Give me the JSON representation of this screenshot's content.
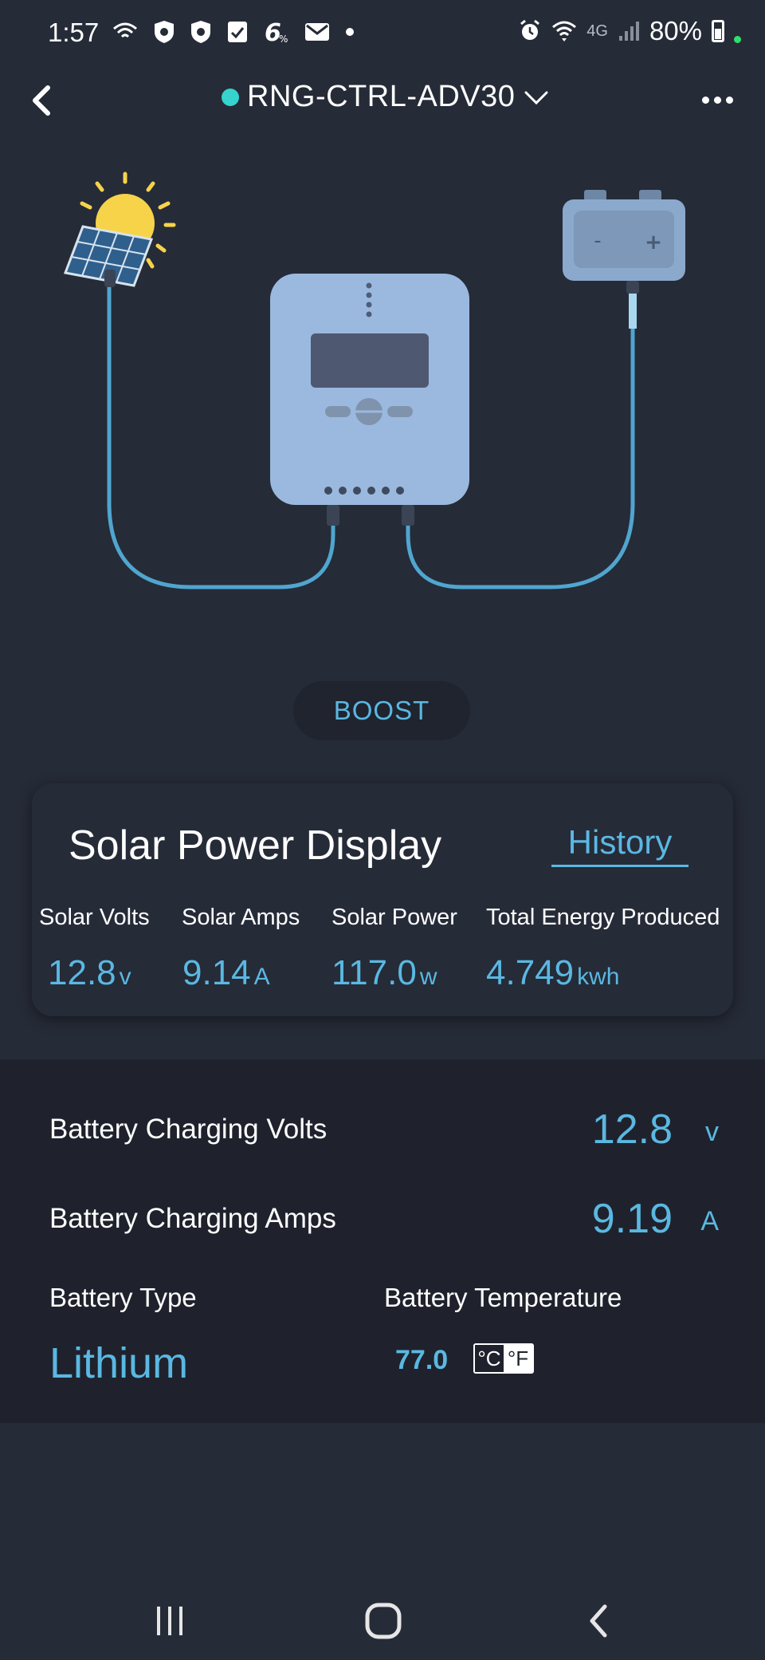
{
  "status_bar": {
    "time": "1:57",
    "left_icons": [
      "wifi-calling-icon",
      "shield-icon",
      "shield-icon",
      "notepad-icon",
      "six-icon",
      "mail-icon",
      "dot-icon"
    ],
    "right_icons": [
      "alarm-icon",
      "wifi-icon",
      "4g-icon",
      "signal-icon"
    ],
    "network": "4G",
    "battery_percent": "80%"
  },
  "header": {
    "device_name": "RNG-CTRL-ADV30",
    "device_status_color": "#36d3cf",
    "back_icon": "chevron-left-icon",
    "dropdown_icon": "chevron-down-icon",
    "more_icon": "more-horizontal-icon"
  },
  "illustration": {
    "battery_minus": "-",
    "battery_plus": "+"
  },
  "boost": {
    "label": "BOOST"
  },
  "solar_power": {
    "title": "Solar Power Display",
    "history_label": "History",
    "metrics": [
      {
        "label": "Solar Volts",
        "value": "12.8",
        "unit": "v"
      },
      {
        "label": "Solar Amps",
        "value": "9.14",
        "unit": "A"
      },
      {
        "label": "Solar Power",
        "value": "117.0",
        "unit": "w"
      },
      {
        "label": "Total Energy Produced",
        "value": "4.749",
        "unit": "kwh"
      }
    ]
  },
  "battery": {
    "charging_volts": {
      "label": "Battery Charging Volts",
      "value": "12.8",
      "unit": "v"
    },
    "charging_amps": {
      "label": "Battery Charging Amps",
      "value": "9.19",
      "unit": "A"
    },
    "type": {
      "label": "Battery Type",
      "value": "Lithium"
    },
    "temperature": {
      "label": "Battery Temperature",
      "value": "77.0",
      "unit_c": "°C",
      "unit_f": "°F",
      "selected_unit": "°F"
    }
  },
  "nav_bar": {
    "recents_icon": "recents-icon",
    "home_icon": "home-icon",
    "back_icon": "back-icon"
  },
  "colors": {
    "background": "#262b38",
    "section_background": "#1f222c",
    "accent": "#5ab8e2",
    "status_dot": "#36d3cf"
  }
}
